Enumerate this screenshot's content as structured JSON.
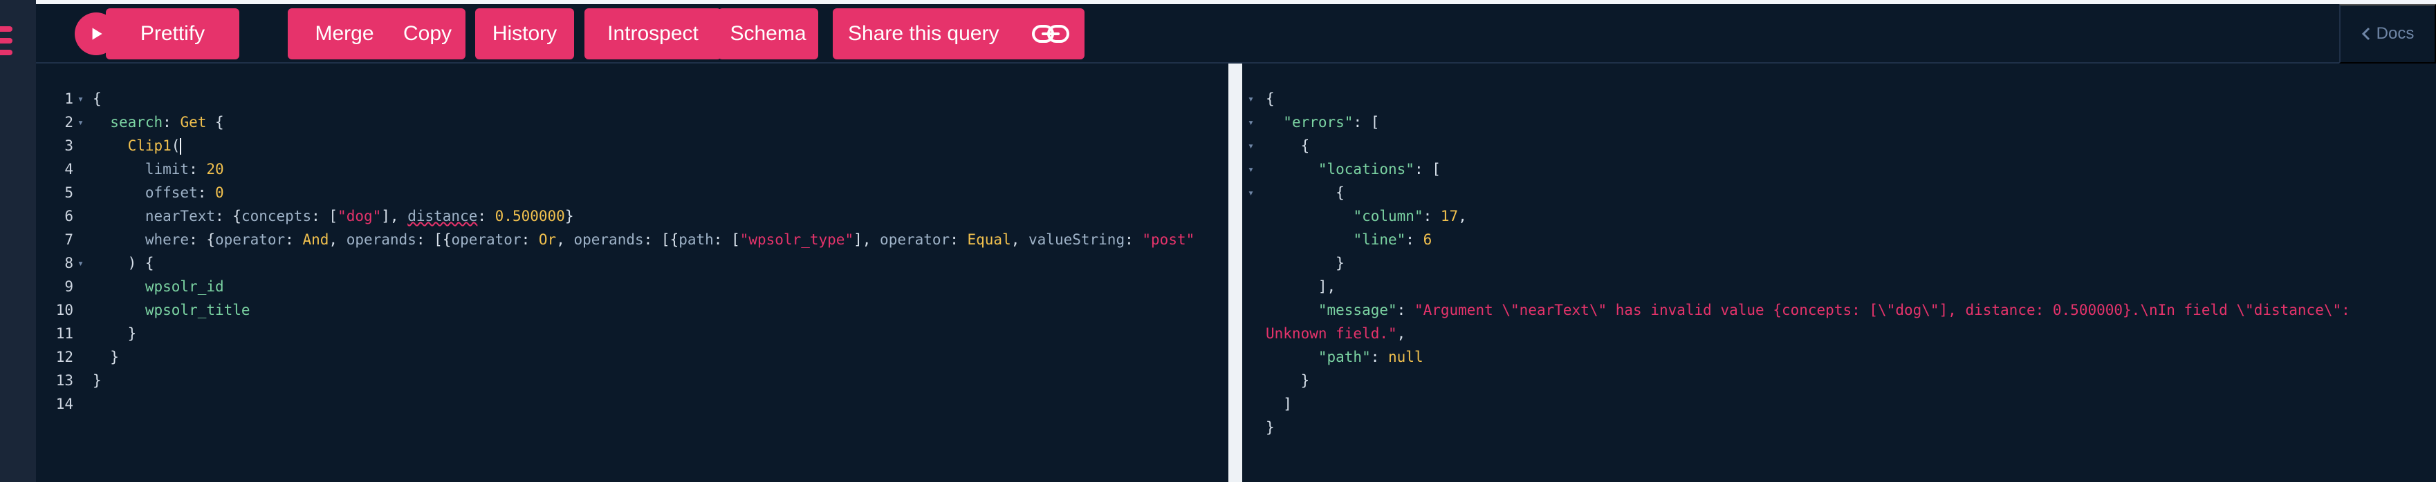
{
  "toolbar": {
    "run_label": "Run",
    "prettify": "Prettify",
    "merge": "Merge",
    "copy": "Copy",
    "history": "History",
    "introspect": "Introspect",
    "schema": "Schema",
    "share": "Share this query",
    "docs": "Docs"
  },
  "query_lines": [
    {
      "num": "1",
      "fold": "▾",
      "parts": [
        {
          "t": "{",
          "c": "p"
        }
      ]
    },
    {
      "num": "2",
      "fold": "▾",
      "parts": [
        {
          "t": "  ",
          "c": "p"
        },
        {
          "t": "search",
          "c": "k"
        },
        {
          "t": ": ",
          "c": "p"
        },
        {
          "t": "Get",
          "c": "t"
        },
        {
          "t": " {",
          "c": "p"
        }
      ]
    },
    {
      "num": "3",
      "fold": "",
      "parts": [
        {
          "t": "    ",
          "c": "p"
        },
        {
          "t": "Clip1",
          "c": "n"
        },
        {
          "t": "(",
          "c": "p"
        },
        {
          "cursor": true
        }
      ]
    },
    {
      "num": "4",
      "fold": "",
      "parts": [
        {
          "t": "      ",
          "c": "p"
        },
        {
          "t": "limit",
          "c": "att"
        },
        {
          "t": ": ",
          "c": "p"
        },
        {
          "t": "20",
          "c": "n"
        }
      ]
    },
    {
      "num": "5",
      "fold": "",
      "parts": [
        {
          "t": "      ",
          "c": "p"
        },
        {
          "t": "offset",
          "c": "att"
        },
        {
          "t": ": ",
          "c": "p"
        },
        {
          "t": "0",
          "c": "n"
        }
      ]
    },
    {
      "num": "6",
      "fold": "",
      "parts": [
        {
          "t": "      ",
          "c": "p"
        },
        {
          "t": "nearText",
          "c": "att"
        },
        {
          "t": ": {",
          "c": "p"
        },
        {
          "t": "concepts",
          "c": "att"
        },
        {
          "t": ": [",
          "c": "p"
        },
        {
          "t": "\"dog\"",
          "c": "s"
        },
        {
          "t": "], ",
          "c": "p"
        },
        {
          "t": "distance",
          "c": "att",
          "squiggle": true
        },
        {
          "t": ": ",
          "c": "p"
        },
        {
          "t": "0.500000",
          "c": "n"
        },
        {
          "t": "}",
          "c": "p"
        }
      ]
    },
    {
      "num": "7",
      "fold": "",
      "parts": [
        {
          "t": "      ",
          "c": "p"
        },
        {
          "t": "where",
          "c": "att"
        },
        {
          "t": ": {",
          "c": "p"
        },
        {
          "t": "operator",
          "c": "att"
        },
        {
          "t": ": ",
          "c": "p"
        },
        {
          "t": "And",
          "c": "t"
        },
        {
          "t": ", ",
          "c": "p"
        },
        {
          "t": "operands",
          "c": "att"
        },
        {
          "t": ": [{",
          "c": "p"
        },
        {
          "t": "operator",
          "c": "att"
        },
        {
          "t": ": ",
          "c": "p"
        },
        {
          "t": "Or",
          "c": "t"
        },
        {
          "t": ", ",
          "c": "p"
        },
        {
          "t": "operands",
          "c": "att"
        },
        {
          "t": ": [{",
          "c": "p"
        },
        {
          "t": "path",
          "c": "att"
        },
        {
          "t": ": [",
          "c": "p"
        },
        {
          "t": "\"wpsolr_type\"",
          "c": "s"
        },
        {
          "t": "], ",
          "c": "p"
        },
        {
          "t": "operator",
          "c": "att"
        },
        {
          "t": ": ",
          "c": "p"
        },
        {
          "t": "Equal",
          "c": "t"
        },
        {
          "t": ", ",
          "c": "p"
        },
        {
          "t": "valueString",
          "c": "att"
        },
        {
          "t": ": ",
          "c": "p"
        },
        {
          "t": "\"post\"",
          "c": "s"
        }
      ]
    },
    {
      "num": "8",
      "fold": "▾",
      "parts": [
        {
          "t": "    ",
          "c": "p"
        },
        {
          "t": ")",
          "c": "p"
        },
        {
          "t": " {",
          "c": "p"
        }
      ]
    },
    {
      "num": "9",
      "fold": "",
      "parts": [
        {
          "t": "      ",
          "c": "p"
        },
        {
          "t": "wpsolr_id",
          "c": "k"
        }
      ]
    },
    {
      "num": "10",
      "fold": "",
      "parts": [
        {
          "t": "      ",
          "c": "p"
        },
        {
          "t": "wpsolr_title",
          "c": "k"
        }
      ]
    },
    {
      "num": "11",
      "fold": "",
      "parts": [
        {
          "t": "    }",
          "c": "p"
        }
      ]
    },
    {
      "num": "12",
      "fold": "",
      "parts": [
        {
          "t": "  }",
          "c": "p"
        }
      ]
    },
    {
      "num": "13",
      "fold": "",
      "parts": [
        {
          "t": "}",
          "c": "p"
        }
      ]
    },
    {
      "num": "14",
      "fold": "",
      "parts": []
    }
  ],
  "result_lines": [
    {
      "fold": "▾",
      "parts": [
        {
          "t": "{",
          "c": "p"
        }
      ]
    },
    {
      "fold": "▾",
      "parts": [
        {
          "t": "  ",
          "c": "p"
        },
        {
          "t": "\"errors\"",
          "c": "jk"
        },
        {
          "t": ": [",
          "c": "p"
        }
      ]
    },
    {
      "fold": "▾",
      "parts": [
        {
          "t": "    {",
          "c": "p"
        }
      ]
    },
    {
      "fold": "▾",
      "parts": [
        {
          "t": "      ",
          "c": "p"
        },
        {
          "t": "\"locations\"",
          "c": "jk"
        },
        {
          "t": ": [",
          "c": "p"
        }
      ]
    },
    {
      "fold": "▾",
      "parts": [
        {
          "t": "        {",
          "c": "p"
        }
      ]
    },
    {
      "fold": "",
      "parts": [
        {
          "t": "          ",
          "c": "p"
        },
        {
          "t": "\"column\"",
          "c": "jk"
        },
        {
          "t": ": ",
          "c": "p"
        },
        {
          "t": "17",
          "c": "jn"
        },
        {
          "t": ",",
          "c": "p"
        }
      ]
    },
    {
      "fold": "",
      "parts": [
        {
          "t": "          ",
          "c": "p"
        },
        {
          "t": "\"line\"",
          "c": "jk"
        },
        {
          "t": ": ",
          "c": "p"
        },
        {
          "t": "6",
          "c": "jn"
        }
      ]
    },
    {
      "fold": "",
      "parts": [
        {
          "t": "        }",
          "c": "p"
        }
      ]
    },
    {
      "fold": "",
      "parts": [
        {
          "t": "      ],",
          "c": "p"
        }
      ]
    },
    {
      "fold": "",
      "parts": [
        {
          "t": "      ",
          "c": "p"
        },
        {
          "t": "\"message\"",
          "c": "jk"
        },
        {
          "t": ": ",
          "c": "p"
        },
        {
          "t": "\"Argument \\\"nearText\\\" has invalid value {concepts: [\\\"dog\\\"], distance: 0.500000}.\\nIn field \\\"distance\\\":",
          "c": "js"
        }
      ]
    },
    {
      "fold": "",
      "parts": [
        {
          "t": "Unknown field.\"",
          "c": "js"
        },
        {
          "t": ",",
          "c": "p"
        }
      ]
    },
    {
      "fold": "",
      "parts": [
        {
          "t": "      ",
          "c": "p"
        },
        {
          "t": "\"path\"",
          "c": "jk"
        },
        {
          "t": ": ",
          "c": "p"
        },
        {
          "t": "null",
          "c": "jn"
        }
      ]
    },
    {
      "fold": "",
      "parts": [
        {
          "t": "    }",
          "c": "p"
        }
      ]
    },
    {
      "fold": "",
      "parts": [
        {
          "t": "  ]",
          "c": "p"
        }
      ]
    },
    {
      "fold": "",
      "parts": [
        {
          "t": "}",
          "c": "p"
        }
      ]
    }
  ]
}
